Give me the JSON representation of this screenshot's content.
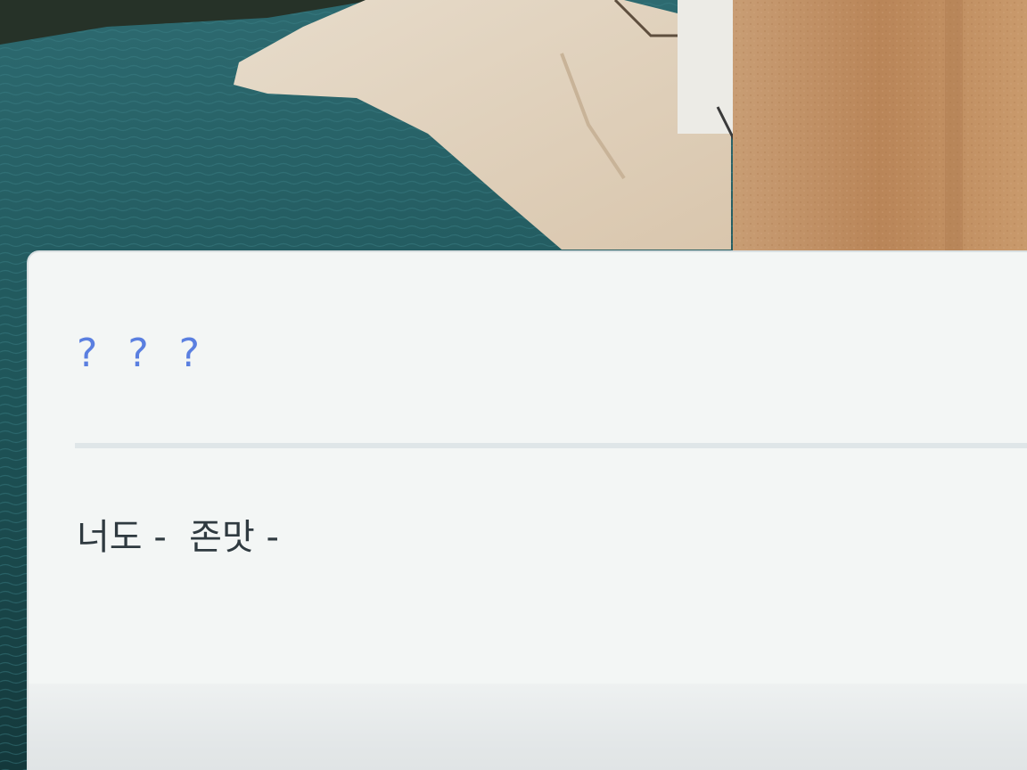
{
  "background": {
    "image": "photo-background"
  },
  "dialog": {
    "title": "? ? ?",
    "message": "너도 -  존맛 -"
  },
  "colors": {
    "title": "#5a7fe0",
    "message": "#2f3a40",
    "card": "#f3f6f5",
    "divider": "#dfe6e8"
  }
}
